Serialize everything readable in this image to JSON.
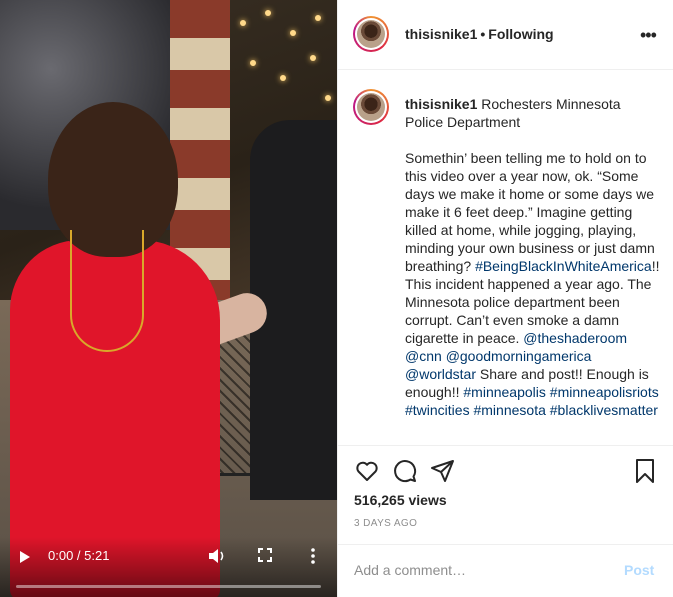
{
  "video": {
    "time_display": "0:00 / 5:21",
    "icons": [
      "play-icon",
      "volume-icon",
      "fullscreen-icon",
      "more-vertical-icon"
    ]
  },
  "header": {
    "username": "thisisnike1",
    "separator": "•",
    "follow_status": "Following",
    "options_label": "•••"
  },
  "caption": {
    "username": "thisisnike1",
    "location_text": "Rochesters Minnesota Police Department",
    "body_segments": [
      {
        "type": "text",
        "value": "Somethin’ been telling me to hold on to this video over a year now, ok. “Some days we make it home or some days we make it 6 feet deep.” Imagine getting killed at home, while jogging, playing, minding your own business or just damn breathing? "
      },
      {
        "type": "tag",
        "value": "#BeingBlackInWhiteAmerica"
      },
      {
        "type": "text",
        "value": "!! This incident happened a year ago. The Minnesota police department been corrupt. Can’t even smoke a damn cigarette in peace. "
      },
      {
        "type": "tag",
        "value": "@theshaderoom"
      },
      {
        "type": "text",
        "value": " "
      },
      {
        "type": "tag",
        "value": "@cnn"
      },
      {
        "type": "text",
        "value": " "
      },
      {
        "type": "tag",
        "value": "@goodmorningamerica"
      },
      {
        "type": "text",
        "value": " "
      },
      {
        "type": "tag",
        "value": "@worldstar"
      },
      {
        "type": "text",
        "value": " Share and post!! Enough is enough!! "
      },
      {
        "type": "tag",
        "value": "#minneapolis"
      },
      {
        "type": "text",
        "value": " "
      },
      {
        "type": "tag",
        "value": "#minneapolisriots"
      },
      {
        "type": "text",
        "value": " "
      },
      {
        "type": "tag",
        "value": "#twincities"
      },
      {
        "type": "text",
        "value": " "
      },
      {
        "type": "tag",
        "value": "#minnesota"
      },
      {
        "type": "text",
        "value": " "
      },
      {
        "type": "tag",
        "value": "#blacklivesmatter"
      }
    ]
  },
  "actions": {
    "icons": [
      "heart-icon",
      "comment-icon",
      "share-icon",
      "bookmark-icon"
    ],
    "views": "516,265 views",
    "age": "3 DAYS AGO"
  },
  "comment": {
    "placeholder": "Add a comment…",
    "post_label": "Post"
  },
  "colors": {
    "link": "#00376b",
    "post_disabled": "#b3dbff",
    "secondary_text": "#8e8e8e",
    "video_shirt": "#e0152a"
  }
}
